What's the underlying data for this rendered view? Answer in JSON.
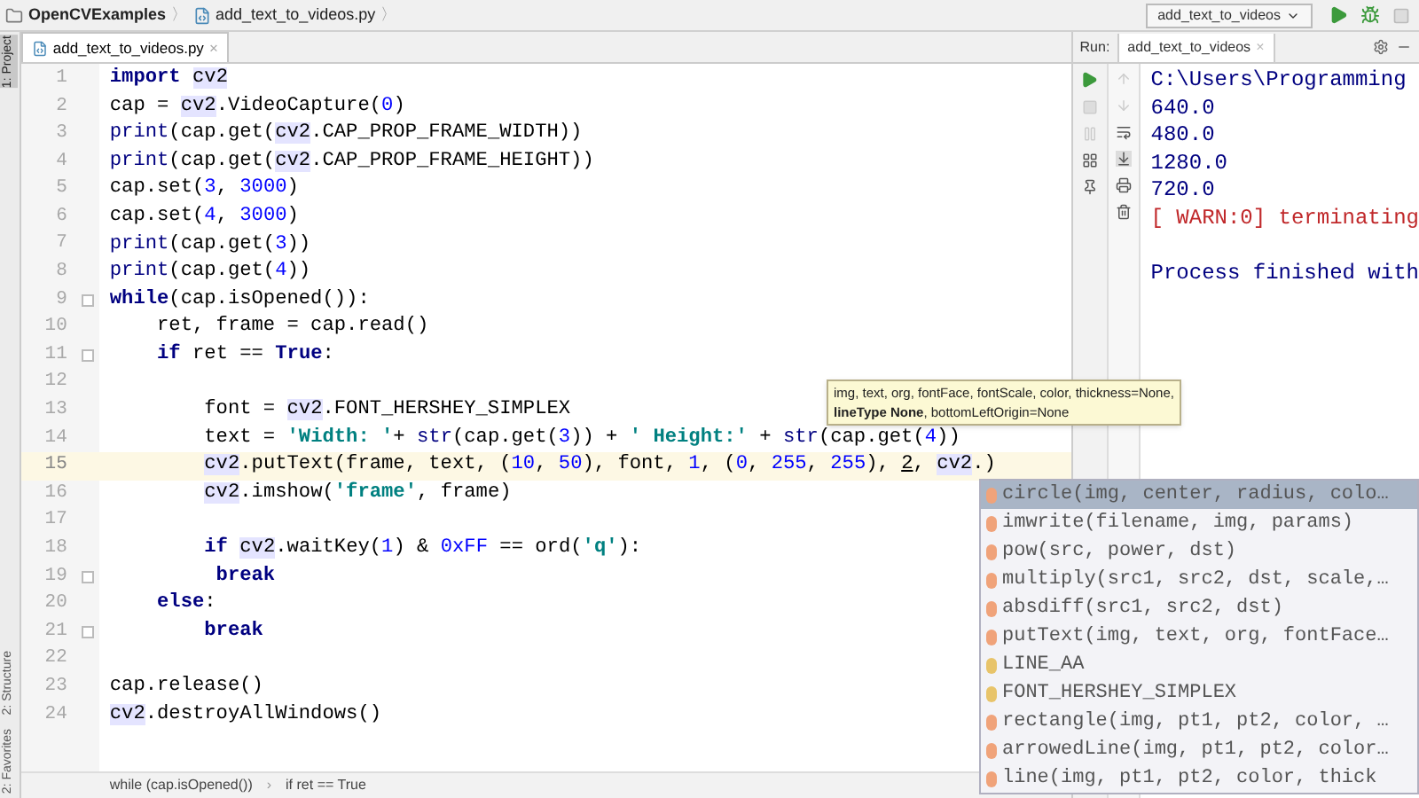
{
  "breadcrumb": {
    "project": "OpenCVExamples",
    "separator": "〉",
    "file": "add_text_to_videos.py"
  },
  "run_config": {
    "label": "add_text_to_videos"
  },
  "side_tabs": [
    {
      "label": "1: Project",
      "selected": true
    },
    {
      "label": "2: Structure",
      "selected": false
    },
    {
      "label": "2: Favorites",
      "selected": false
    }
  ],
  "editor_tabs": [
    {
      "label": "add_text_to_videos.py",
      "close": "×",
      "selected": true
    }
  ],
  "code_lines": [
    {
      "number": "1",
      "current": false,
      "fold": false,
      "tokens": [
        {
          "kind": "kw",
          "text": "import"
        },
        {
          "kind": "hl",
          "text": " cv2"
        }
      ]
    },
    {
      "number": "2",
      "current": false,
      "fold": false,
      "tokens": [
        {
          "kind": "p",
          "text": "cap = "
        },
        {
          "kind": "hl",
          "text": "cv2"
        },
        {
          "kind": "p",
          "text": ".VideoCapture("
        },
        {
          "kind": "num",
          "text": "0"
        },
        {
          "kind": "p",
          "text": ")"
        }
      ]
    },
    {
      "number": "3",
      "current": false,
      "fold": false,
      "tokens": [
        {
          "kind": "bi",
          "text": "print"
        },
        {
          "kind": "p",
          "text": "(cap.get("
        },
        {
          "kind": "hl",
          "text": "cv2"
        },
        {
          "kind": "p",
          "text": ".CAP_PROP_FRAME_WIDTH))"
        }
      ]
    },
    {
      "number": "4",
      "current": false,
      "fold": false,
      "tokens": [
        {
          "kind": "bi",
          "text": "print"
        },
        {
          "kind": "p",
          "text": "(cap.get("
        },
        {
          "kind": "hl",
          "text": "cv2"
        },
        {
          "kind": "p",
          "text": ".CAP_PROP_FRAME_HEIGHT))"
        }
      ]
    },
    {
      "number": "5",
      "current": false,
      "fold": false,
      "tokens": [
        {
          "kind": "p",
          "text": "cap.set("
        },
        {
          "kind": "num",
          "text": "3"
        },
        {
          "kind": "p",
          "text": ", "
        },
        {
          "kind": "num",
          "text": "3000"
        },
        {
          "kind": "p",
          "text": ")"
        }
      ]
    },
    {
      "number": "6",
      "current": false,
      "fold": false,
      "tokens": [
        {
          "kind": "p",
          "text": "cap.set("
        },
        {
          "kind": "num",
          "text": "4"
        },
        {
          "kind": "p",
          "text": ", "
        },
        {
          "kind": "num",
          "text": "3000"
        },
        {
          "kind": "p",
          "text": ")"
        }
      ]
    },
    {
      "number": "7",
      "current": false,
      "fold": false,
      "tokens": [
        {
          "kind": "bi",
          "text": "print"
        },
        {
          "kind": "p",
          "text": "(cap.get("
        },
        {
          "kind": "num",
          "text": "3"
        },
        {
          "kind": "p",
          "text": "))"
        }
      ]
    },
    {
      "number": "8",
      "current": false,
      "fold": false,
      "tokens": [
        {
          "kind": "bi",
          "text": "print"
        },
        {
          "kind": "p",
          "text": "(cap.get("
        },
        {
          "kind": "num",
          "text": "4"
        },
        {
          "kind": "p",
          "text": "))"
        }
      ]
    },
    {
      "number": "9",
      "current": false,
      "fold": true,
      "tokens": [
        {
          "kind": "kw",
          "text": "while"
        },
        {
          "kind": "p",
          "text": "(cap.isOpened()):"
        }
      ]
    },
    {
      "number": "10",
      "current": false,
      "fold": false,
      "tokens": [
        {
          "kind": "p",
          "text": "    ret, frame = cap.read()"
        }
      ]
    },
    {
      "number": "11",
      "current": false,
      "fold": true,
      "tokens": [
        {
          "kind": "kw",
          "text": "    if"
        },
        {
          "kind": "p",
          "text": " ret == "
        },
        {
          "kind": "kw",
          "text": "True"
        },
        {
          "kind": "p",
          "text": ":"
        }
      ]
    },
    {
      "number": "12",
      "current": false,
      "fold": false
    },
    {
      "number": "13",
      "current": false,
      "fold": false,
      "tokens": [
        {
          "kind": "p",
          "text": "        font = "
        },
        {
          "kind": "hl",
          "text": "cv2"
        },
        {
          "kind": "p",
          "text": ".FONT_HERSHEY_SIMPLEX"
        }
      ]
    },
    {
      "number": "14",
      "current": false,
      "fold": false,
      "tokens": [
        {
          "kind": "p",
          "text": "        text = "
        },
        {
          "kind": "str",
          "text": "'Width: '"
        },
        {
          "kind": "p",
          "text": "+ "
        },
        {
          "kind": "bi",
          "text": "str"
        },
        {
          "kind": "p",
          "text": "(cap.get("
        },
        {
          "kind": "num",
          "text": "3"
        },
        {
          "kind": "p",
          "text": ")) + "
        },
        {
          "kind": "str",
          "text": "' Height:'"
        },
        {
          "kind": "p",
          "text": " + "
        },
        {
          "kind": "bi",
          "text": "str"
        },
        {
          "kind": "p",
          "text": "(cap.get("
        },
        {
          "kind": "num",
          "text": "4"
        },
        {
          "kind": "p",
          "text": "))"
        }
      ]
    },
    {
      "number": "15",
      "current": true,
      "fold": false,
      "tokens": [
        {
          "kind": "hl",
          "text": "        cv2"
        },
        {
          "kind": "p",
          "text": ".putText(frame, text, ("
        },
        {
          "kind": "num",
          "text": "10"
        },
        {
          "kind": "p",
          "text": ", "
        },
        {
          "kind": "num",
          "text": "50"
        },
        {
          "kind": "p",
          "text": "), font, "
        },
        {
          "kind": "num",
          "text": "1"
        },
        {
          "kind": "p",
          "text": ", ("
        },
        {
          "kind": "num",
          "text": "0"
        },
        {
          "kind": "p",
          "text": ", "
        },
        {
          "kind": "num",
          "text": "255"
        },
        {
          "kind": "p",
          "text": ", "
        },
        {
          "kind": "num",
          "text": "255"
        },
        {
          "kind": "p",
          "text": "), "
        },
        {
          "kind": "u",
          "text": "2"
        },
        {
          "kind": "p",
          "text": ", "
        },
        {
          "kind": "hl",
          "text": "cv2"
        },
        {
          "kind": "p",
          "text": ".)"
        }
      ]
    },
    {
      "number": "16",
      "current": false,
      "fold": false,
      "tokens": [
        {
          "kind": "hl",
          "text": "        cv2"
        },
        {
          "kind": "p",
          "text": ".imshow("
        },
        {
          "kind": "str",
          "text": "'frame'"
        },
        {
          "kind": "p",
          "text": ", frame)"
        }
      ]
    },
    {
      "number": "17",
      "current": false,
      "fold": false
    },
    {
      "number": "18",
      "current": false,
      "fold": false,
      "tokens": [
        {
          "kind": "kw",
          "text": "        if"
        },
        {
          "kind": "hl",
          "text": " cv2"
        },
        {
          "kind": "p",
          "text": ".waitKey("
        },
        {
          "kind": "num",
          "text": "1"
        },
        {
          "kind": "p",
          "text": ") & "
        },
        {
          "kind": "num",
          "text": "0xFF"
        },
        {
          "kind": "p",
          "text": " == ord("
        },
        {
          "kind": "str",
          "text": "'q'"
        },
        {
          "kind": "p",
          "text": "):"
        }
      ]
    },
    {
      "number": "19",
      "current": false,
      "fold": true,
      "tokens": [
        {
          "kind": "kw",
          "text": "         break"
        }
      ]
    },
    {
      "number": "20",
      "current": false,
      "fold": false,
      "tokens": [
        {
          "kind": "kw",
          "text": "    else"
        },
        {
          "kind": "p",
          "text": ":"
        }
      ]
    },
    {
      "number": "21",
      "current": false,
      "fold": true,
      "tokens": [
        {
          "kind": "kw",
          "text": "        break"
        }
      ]
    },
    {
      "number": "22",
      "current": false,
      "fold": false
    },
    {
      "number": "23",
      "current": false,
      "fold": false,
      "tokens": [
        {
          "kind": "p",
          "text": "cap.release()"
        }
      ]
    },
    {
      "number": "24",
      "current": false,
      "fold": false,
      "tokens": [
        {
          "kind": "hl",
          "text": "cv2"
        },
        {
          "kind": "p",
          "text": ".destroyAllWindows()"
        }
      ]
    }
  ],
  "param_tooltip": {
    "line_1": "img, text, org, fontFace, fontScale, color, thickness=None,",
    "line_2": "**lineType  None**, bottomLeftOrigin=None"
  },
  "completion": [
    {
      "kind": "function",
      "text": "circle(img, center, radius, colo…",
      "selected": true
    },
    {
      "kind": "function",
      "text": "imwrite(filename, img, params)",
      "selected": false
    },
    {
      "kind": "function",
      "text": "pow(src, power, dst)",
      "selected": false
    },
    {
      "kind": "function",
      "text": "multiply(src1, src2, dst, scale,…",
      "selected": false
    },
    {
      "kind": "function",
      "text": "absdiff(src1, src2, dst)",
      "selected": false
    },
    {
      "kind": "function",
      "text": "putText(img, text, org, fontFace…",
      "selected": false
    },
    {
      "kind": "variable",
      "text": "LINE_AA",
      "selected": false
    },
    {
      "kind": "variable",
      "text": "FONT_HERSHEY_SIMPLEX",
      "selected": false
    },
    {
      "kind": "function",
      "text": "rectangle(img, pt1, pt2, color, …",
      "selected": false
    },
    {
      "kind": "function",
      "text": "arrowedLine(img, pt1, pt2, color…",
      "selected": false
    },
    {
      "kind": "function",
      "text": "line(img, pt1, pt2, color, thick",
      "selected": false
    }
  ],
  "run_panel": {
    "label": "Run:",
    "tab": {
      "label": "add_text_to_videos",
      "close": "×"
    },
    "output": [
      {
        "kind": "out",
        "text": "C:\\Users\\Programming"
      },
      {
        "kind": "out",
        "text": "640.0"
      },
      {
        "kind": "out",
        "text": "480.0"
      },
      {
        "kind": "out",
        "text": "1280.0"
      },
      {
        "kind": "out",
        "text": "720.0"
      },
      {
        "kind": "warn",
        "text": "[ WARN:0] terminating"
      },
      {
        "kind": "exit",
        "text": "Process finished with"
      }
    ]
  },
  "structure_breadcrumb": {
    "separator": "›",
    "items": [
      {
        "label": "while (cap.isOpened())"
      },
      {
        "label": "if ret == True"
      }
    ]
  }
}
